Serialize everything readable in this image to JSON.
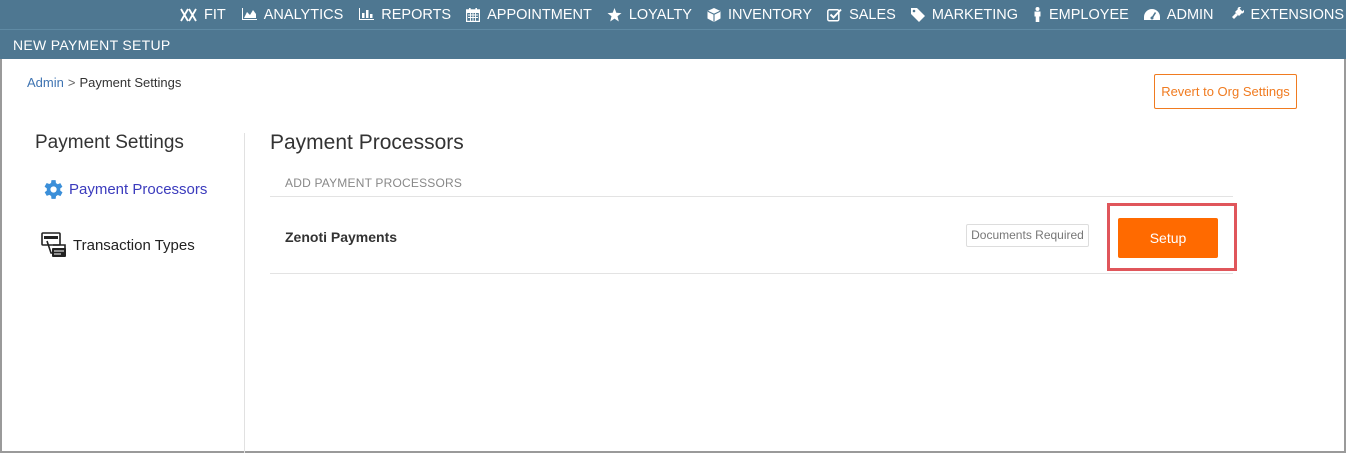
{
  "nav": {
    "items": [
      {
        "label": "FIT",
        "icon": "fit-icon"
      },
      {
        "label": "ANALYTICS",
        "icon": "area-chart-icon"
      },
      {
        "label": "REPORTS",
        "icon": "bar-chart-icon"
      },
      {
        "label": "APPOINTMENT",
        "icon": "calendar-icon"
      },
      {
        "label": "LOYALTY",
        "icon": "star-icon"
      },
      {
        "label": "INVENTORY",
        "icon": "cube-icon"
      },
      {
        "label": "SALES",
        "icon": "checkbox-icon"
      },
      {
        "label": "MARKETING",
        "icon": "tag-icon"
      },
      {
        "label": "EMPLOYEE",
        "icon": "person-icon"
      },
      {
        "label": "ADMIN",
        "icon": "dashboard-icon"
      },
      {
        "label": "EXTENSIONS",
        "icon": "plug-icon"
      }
    ]
  },
  "subheader": {
    "title": "NEW PAYMENT SETUP"
  },
  "breadcrumb": {
    "root": "Admin",
    "separator": ">",
    "current": "Payment Settings"
  },
  "revert_button": {
    "label": "Revert to Org Settings"
  },
  "sidebar": {
    "title": "Payment Settings",
    "items": [
      {
        "label": "Payment Processors",
        "icon": "gear-icon",
        "active": true
      },
      {
        "label": "Transaction Types",
        "icon": "payment-terminal-icon",
        "active": false
      }
    ]
  },
  "main": {
    "title": "Payment Processors",
    "section_label": "ADD PAYMENT PROCESSORS",
    "processors": [
      {
        "name": "Zenoti Payments",
        "badge": "Documents Required",
        "action": "Setup"
      }
    ]
  },
  "colors": {
    "header_bg": "#4e7791",
    "accent_orange": "#ff6a00",
    "link_blue": "#3f74b2",
    "active_item": "#3b3bbd",
    "highlight_red": "#e0565b"
  }
}
